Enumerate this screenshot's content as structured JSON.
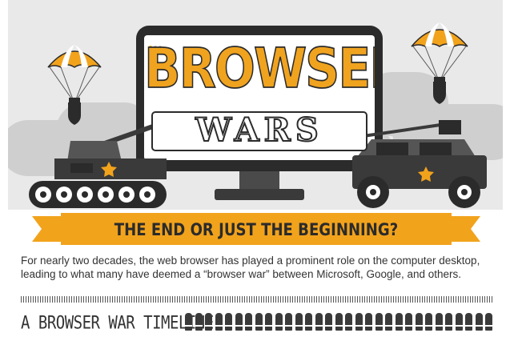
{
  "hero": {
    "title_line1": "BROWSER",
    "title_line2": "WARS"
  },
  "banner": {
    "text": "THE END OR JUST THE BEGINNING?"
  },
  "intro": {
    "text": "For nearly two decades, the web browser has played a prominent role on the computer desktop, leading to what many have deemed a “browser war” between Microsoft, Google, and others."
  },
  "section": {
    "heading": "A BROWSER WAR TIMELINE"
  },
  "icons": [
    "parachute-bomb-icon",
    "tank-icon",
    "humvee-icon",
    "star-icon",
    "bullet-icon"
  ],
  "colors": {
    "accent": "#f2a31c",
    "dark": "#2b2b2b",
    "sky": "#e9e9e9",
    "cloud": "#cfcfcf"
  }
}
